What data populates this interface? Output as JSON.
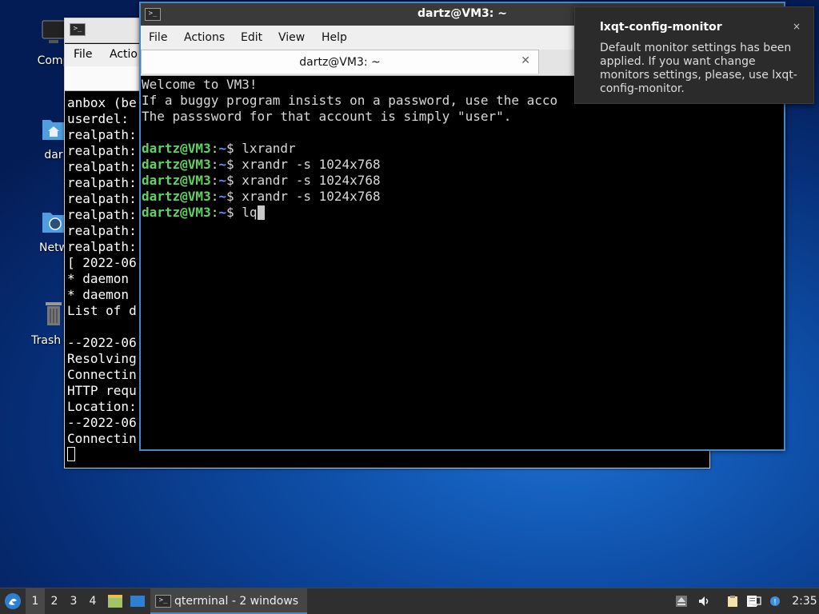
{
  "desktop": {
    "icons": [
      {
        "label": "Comp"
      },
      {
        "label": "dar"
      },
      {
        "label": "Netw"
      },
      {
        "label": "Trash (E"
      }
    ]
  },
  "back_window": {
    "menu": [
      "File",
      "Actio"
    ],
    "terminal_lines": [
      "anbox (be",
      "userdel: ",
      "realpath:",
      "realpath:",
      "realpath:",
      "realpath:",
      "realpath:",
      "realpath:",
      "realpath:",
      "realpath:",
      "[ 2022-06",
      "* daemon ",
      "* daemon ",
      "List of d",
      "",
      "--2022-06",
      "Resolving",
      "Connectin",
      "HTTP requ",
      "Location:",
      "--2022-06",
      "Connectin"
    ]
  },
  "front_window": {
    "title": "dartz@VM3: ~",
    "menu": [
      "File",
      "Actions",
      "Edit",
      "View",
      "Help"
    ],
    "tab_title": "dartz@VM3: ~",
    "terminal": {
      "welcome": [
        "Welcome to VM3!",
        "If a buggy program insists on a password, use the acco",
        "The passsword for that account is simply \"user\"."
      ],
      "prompt_user": "dartz@VM3",
      "prompt_sep": ":",
      "prompt_path": "~",
      "prompt_dollar": "$",
      "commands": [
        " lxrandr",
        " xrandr -s 1024x768",
        " xrandr -s 1024x768",
        " xrandr -s 1024x768"
      ],
      "current_input": " lq"
    }
  },
  "notification": {
    "title": "lxqt-config-monitor",
    "close": "×",
    "body": "Default monitor settings has been applied. If you want change monitors settings, please, use lxqt-config-monitor."
  },
  "taskbar": {
    "workspaces": [
      "1",
      "2",
      "3",
      "4"
    ],
    "active_workspace": "1",
    "task_label": "qterminal - 2 windows",
    "clock": "2:35"
  },
  "colors": {
    "prompt_user": "#5fd35f",
    "prompt_path": "#6b8cff",
    "accent": "#4a86c8"
  }
}
